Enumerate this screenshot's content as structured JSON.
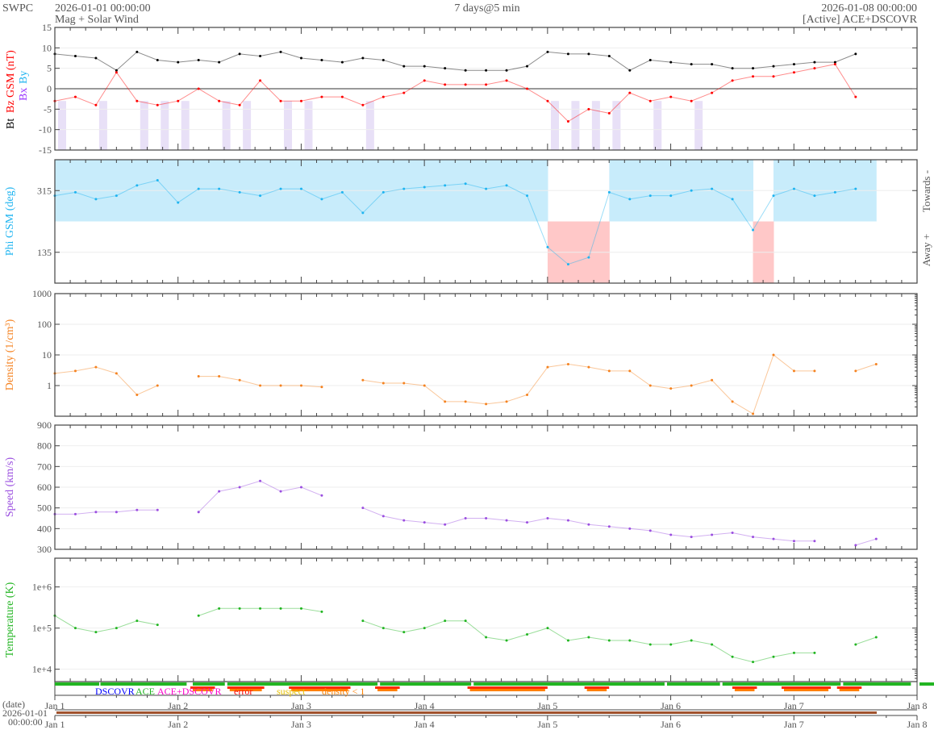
{
  "header": {
    "brand": "SWPC",
    "start": "2026-01-01 00:00:00",
    "title": "Mag + Solar Wind",
    "span": "7 days@5 min",
    "end": "2026-01-08 00:00:00",
    "source": "[Active] ACE+DSCOVR"
  },
  "colors": {
    "bt": "#000000",
    "bz": "#ff0000",
    "bx": "#9933ff",
    "by": "#1fb4f0",
    "phi": "#1fb4f0",
    "density": "#f58220",
    "speed": "#9b4fe0",
    "temperature": "#22b522",
    "towards": "#c8ecfb",
    "away": "#ffc8c8",
    "southward": "#e2d8f5"
  },
  "chart_data": {
    "type": "line",
    "x_unit": "days since 2026-01-01 00:00 (4-hour samples)",
    "x_step_days": 0.1667,
    "x_tick_labels": [
      "Jan 1",
      "Jan 2",
      "Jan 3",
      "Jan 4",
      "Jan 5",
      "Jan 6",
      "Jan 7",
      "Jan 8"
    ],
    "xlim_days": [
      0,
      7
    ],
    "panels": [
      {
        "id": "mag",
        "ylabel_bt": "Bt",
        "ylabel": "Bz GSM (nT)",
        "ylabel_bx": "Bx",
        "ylabel_by": "By",
        "ylim": [
          -15,
          15
        ],
        "yticks": [
          "15",
          "10",
          "5",
          "0",
          "-5",
          "-10",
          "-15"
        ],
        "series": [
          {
            "name": "Bt",
            "values": [
              8.5,
              8,
              7.5,
              4.5,
              9,
              7,
              6.5,
              7,
              6.5,
              8.5,
              8,
              9,
              7.5,
              7,
              6.5,
              7.5,
              7,
              5.5,
              5.5,
              5,
              4.5,
              4.5,
              4.5,
              5.5,
              9,
              8.5,
              8.5,
              8,
              4.5,
              7,
              6.5,
              6,
              6,
              5,
              5,
              5.5,
              6,
              6.5,
              6.5,
              8.5
            ]
          },
          {
            "name": "Bz",
            "values": [
              -3,
              -2,
              -4,
              4,
              -3,
              -4,
              -3,
              0,
              -3,
              -4,
              2,
              -3,
              -3,
              -2,
              -2,
              -4,
              -2,
              -1,
              2,
              1,
              1,
              1,
              2,
              0,
              -3,
              -8,
              -5,
              -6,
              -1,
              -3,
              -2,
              -3,
              -1,
              2,
              3,
              3,
              4,
              5,
              6,
              -2
            ]
          }
        ]
      },
      {
        "id": "phi",
        "ylabel": "Phi GSM (deg)",
        "ylim": [
          45,
          405
        ],
        "yticks": [
          "315",
          "135"
        ],
        "right_labels": [
          "Towards -",
          "Away +"
        ],
        "series": [
          {
            "name": "Phi",
            "values": [
              300,
              310,
              290,
              300,
              330,
              345,
              280,
              320,
              320,
              310,
              300,
              320,
              320,
              290,
              310,
              250,
              310,
              320,
              325,
              330,
              335,
              320,
              330,
              300,
              150,
              100,
              120,
              310,
              290,
              300,
              300,
              315,
              320,
              290,
              200,
              300,
              320,
              300,
              310,
              320
            ]
          }
        ]
      },
      {
        "id": "density",
        "ylabel": "Density (1/cm³)",
        "scale": "log",
        "ylim": [
          0.1,
          1000
        ],
        "yticks": [
          "1000",
          "100",
          "10",
          "1"
        ],
        "series": [
          {
            "name": "Density",
            "values": [
              2.5,
              3,
              4,
              2.5,
              0.5,
              1,
              null,
              2,
              2,
              1.5,
              1,
              1,
              1,
              0.9,
              null,
              1.5,
              1.2,
              1.2,
              1,
              0.3,
              0.3,
              0.25,
              0.3,
              0.5,
              4,
              5,
              4,
              3,
              3,
              1,
              0.8,
              1,
              1.5,
              0.3,
              0.12,
              10,
              3,
              3,
              null,
              3,
              5
            ]
          }
        ]
      },
      {
        "id": "speed",
        "ylabel": "Speed (km/s)",
        "ylim": [
          300,
          900
        ],
        "yticks": [
          "900",
          "800",
          "700",
          "600",
          "500",
          "400",
          "300"
        ],
        "series": [
          {
            "name": "Speed",
            "values": [
              470,
              470,
              480,
              480,
              490,
              490,
              null,
              480,
              580,
              600,
              630,
              580,
              600,
              560,
              null,
              500,
              460,
              440,
              430,
              420,
              450,
              450,
              440,
              430,
              450,
              440,
              420,
              410,
              400,
              390,
              370,
              360,
              370,
              380,
              360,
              350,
              340,
              340,
              null,
              320,
              350
            ]
          }
        ]
      },
      {
        "id": "temperature",
        "ylabel": "Temperature (K)",
        "scale": "log",
        "ylim": [
          5000,
          5000000
        ],
        "yticks": [
          "1e+6",
          "1e+5",
          "1e+4"
        ],
        "series": [
          {
            "name": "Temperature",
            "values": [
              200000,
              100000,
              80000,
              100000,
              150000,
              120000,
              null,
              200000,
              300000,
              300000,
              300000,
              300000,
              300000,
              250000,
              null,
              150000,
              100000,
              80000,
              100000,
              150000,
              150000,
              60000,
              50000,
              70000,
              100000,
              50000,
              60000,
              50000,
              50000,
              40000,
              40000,
              50000,
              40000,
              20000,
              15000,
              20000,
              25000,
              25000,
              null,
              40000,
              60000
            ]
          }
        ]
      }
    ],
    "source_legend": [
      {
        "label": "DSCOVR",
        "color": "#0000ff"
      },
      {
        "label": "ACE",
        "color": "#22b522"
      },
      {
        "label": "ACE+DSCOVR",
        "color": "#ff00cc"
      },
      {
        "label": "error",
        "color": "#ff0000"
      },
      {
        "label": "suspect",
        "color": "#e6c000"
      },
      {
        "label": "density < 1",
        "color": "#ff8000"
      }
    ],
    "active_source_days": [
      [
        0,
        0.36
      ],
      [
        0.37,
        1.07
      ],
      [
        1.12,
        1.38
      ],
      [
        1.4,
        2.62
      ],
      [
        2.64,
        3.38
      ],
      [
        3.4,
        4.95
      ],
      [
        4.97,
        5.4
      ],
      [
        5.42,
        6.38
      ],
      [
        6.4,
        6.95
      ],
      [
        7.02,
        7.7
      ]
    ],
    "flag_days": [
      [
        1.1,
        1.3
      ],
      [
        1.4,
        1.7
      ],
      [
        1.9,
        2.4
      ],
      [
        2.6,
        2.8
      ],
      [
        3.35,
        4.0
      ],
      [
        4.3,
        4.5
      ],
      [
        5.5,
        5.7
      ],
      [
        5.9,
        6.3
      ],
      [
        6.35,
        6.55
      ]
    ],
    "timeline": {
      "label": "(date)",
      "date": "2026-01-01",
      "time": "00:00:00"
    }
  }
}
